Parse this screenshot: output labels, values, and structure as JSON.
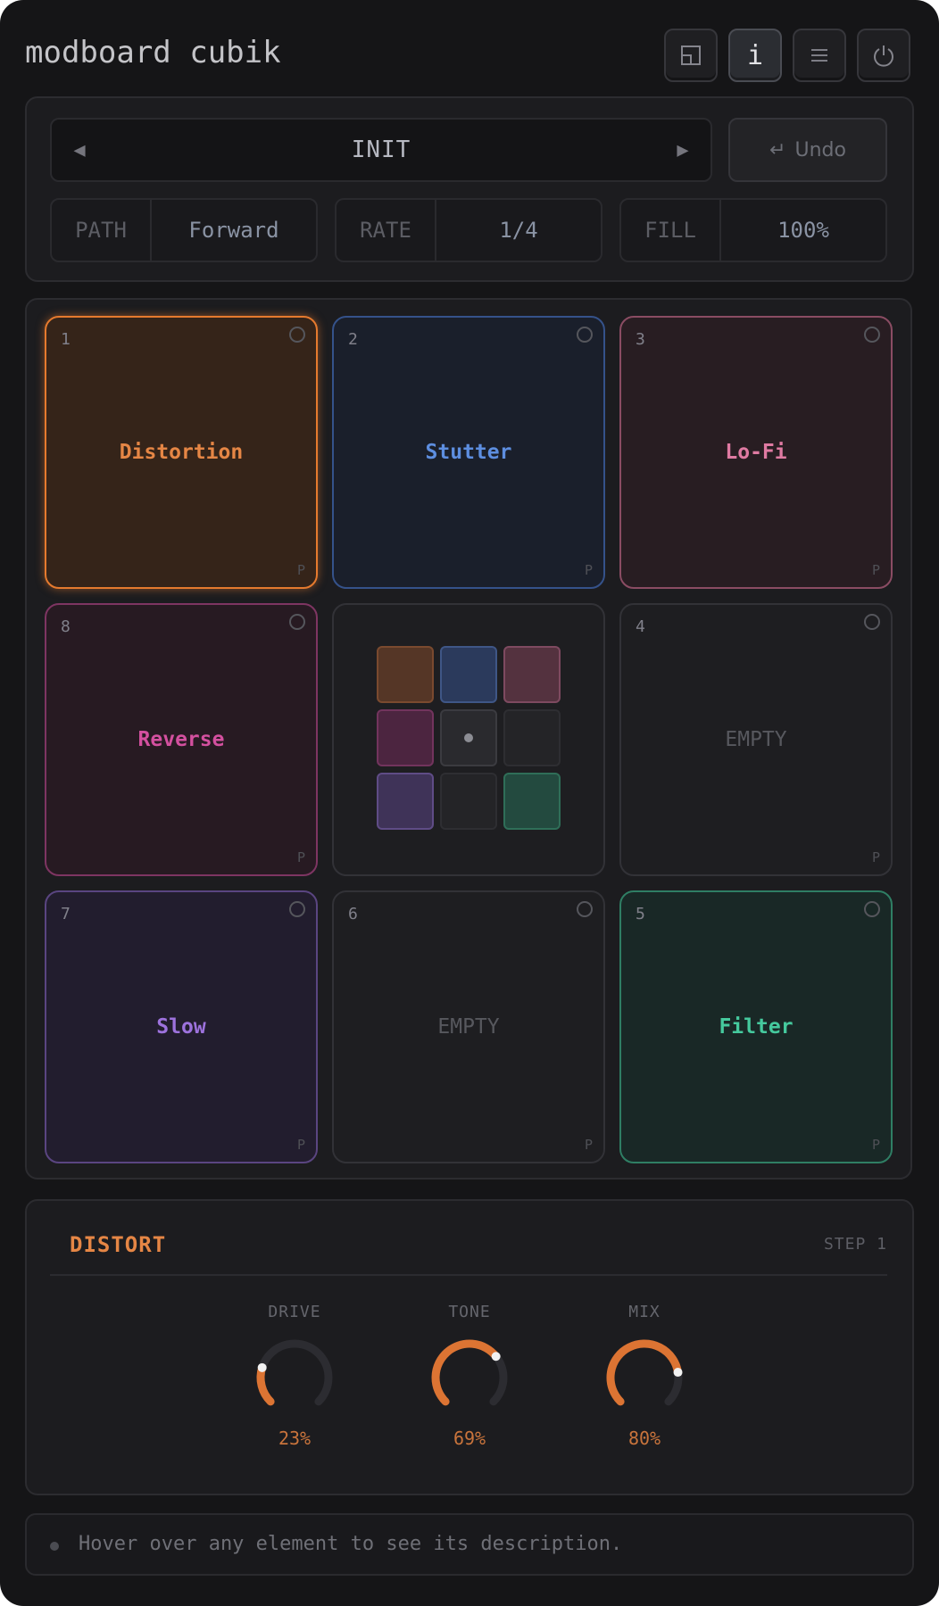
{
  "header": {
    "title": "modboard cubik",
    "buttons": [
      {
        "name": "layout",
        "icon": "window-icon"
      },
      {
        "name": "info",
        "icon": "info-icon",
        "label": "i",
        "active": true
      },
      {
        "name": "menu",
        "icon": "menu-icon"
      },
      {
        "name": "power",
        "icon": "power-icon"
      }
    ]
  },
  "preset": {
    "name": "INIT",
    "prev_icon": "triangle-left-icon",
    "next_icon": "triangle-right-icon",
    "undo_icon": "return-arrow-icon",
    "undo_label": "Undo"
  },
  "params": [
    {
      "label": "PATH",
      "value": "Forward"
    },
    {
      "label": "RATE",
      "value": "1/4"
    },
    {
      "label": "FILL",
      "value": "100%"
    }
  ],
  "pads": [
    {
      "num": "1",
      "label": "Distortion",
      "corner": "P",
      "color": "#e57a2e",
      "selected": true
    },
    {
      "num": "2",
      "label": "Stutter",
      "corner": "P",
      "color": "#4a7bd0"
    },
    {
      "num": "3",
      "label": "Lo-Fi",
      "corner": "P",
      "color": "#d66b95"
    },
    {
      "num": "8",
      "label": "Reverse",
      "corner": "P",
      "color": "#c94a92"
    },
    {
      "num": "4",
      "label": "EMPTY",
      "corner": "P",
      "empty": true
    },
    {
      "num": "7",
      "label": "Slow",
      "corner": "P",
      "color": "#9a6ad8"
    },
    {
      "num": "6",
      "label": "EMPTY",
      "corner": "P",
      "empty": true
    },
    {
      "num": "5",
      "label": "Filter",
      "corner": "P",
      "color": "#3dc49a"
    }
  ],
  "mini_grid": [
    "#e57a2e",
    "#4a7bd0",
    "#d66b95",
    "#c94a92",
    "center",
    "empty",
    "#9a6ad8",
    "empty",
    "#3dc49a"
  ],
  "effect": {
    "title": "DISTORT",
    "step": "STEP 1",
    "knobs": [
      {
        "label": "DRIVE",
        "value": "23%",
        "level": 0.23
      },
      {
        "label": "TONE",
        "value": "69%",
        "level": 0.69
      },
      {
        "label": "MIX",
        "value": "80%",
        "level": 0.8
      }
    ]
  },
  "status": {
    "text": "Hover over any element to see its description."
  },
  "colors": {
    "accent": "#e58645",
    "knob_track": "#2c2c31"
  }
}
